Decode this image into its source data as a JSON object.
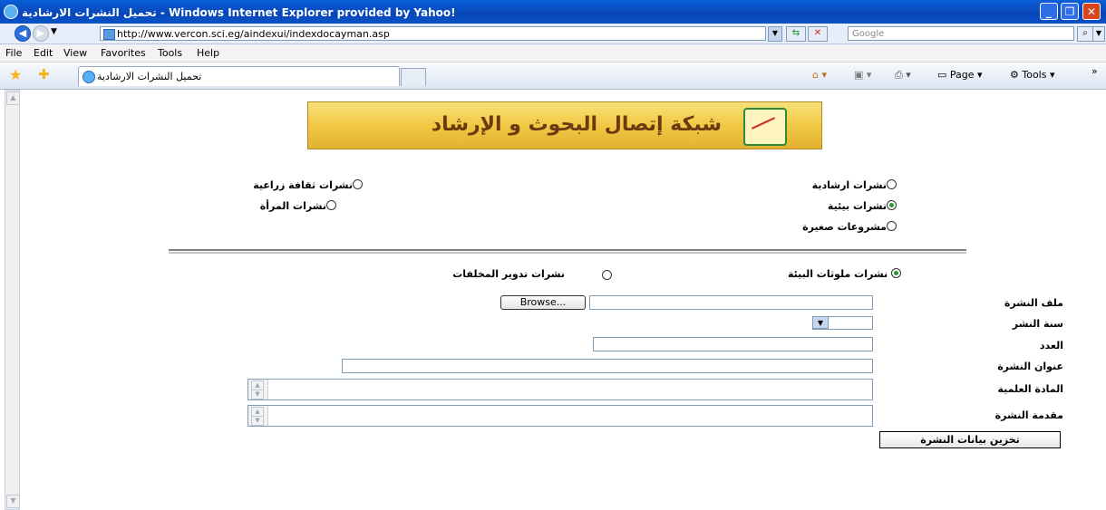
{
  "window": {
    "title": "تحميل النشرات الارشادية - Windows Internet Explorer provided by Yahoo!",
    "min": "_",
    "max": "❐",
    "close": "✕"
  },
  "address": {
    "url": "http://www.vercon.sci.eg/aindexui/indexdocayman.asp",
    "search_placeholder": "Google"
  },
  "menu": {
    "file": "File",
    "edit": "Edit",
    "view": "View",
    "favorites": "Favorites",
    "tools": "Tools",
    "help": "Help"
  },
  "tab": {
    "label": "تحميل النشرات الارشادية"
  },
  "toolbar": {
    "page": "Page",
    "tools": "Tools",
    "more": "»"
  },
  "banner": {
    "text": "شبكة إتصال البحوث و الإرشاد"
  },
  "categories": {
    "extension": "نشرات ارشادية",
    "agri_culture": "نشرات ثقافة زراعية",
    "environmental": "نشرات بيئية",
    "women": "نشرات المرأة",
    "small_projects": "مشروعات صغيرة",
    "selected": "environmental"
  },
  "subcategories": {
    "pollutants": "نشرات ملوثات البيئة",
    "recycling": "نشرات تدوير المخلفات",
    "selected": "pollutants"
  },
  "form": {
    "file_label": "ملف النشرة",
    "browse_label": "Browse...",
    "year_label": "سنة النشر",
    "issue_label": "العدد",
    "title_label": "عنوان النشرة",
    "content_label": "المادة العلمية",
    "intro_label": "مقدمة النشرة",
    "submit_label": "تخزين بيانات النشرة"
  }
}
